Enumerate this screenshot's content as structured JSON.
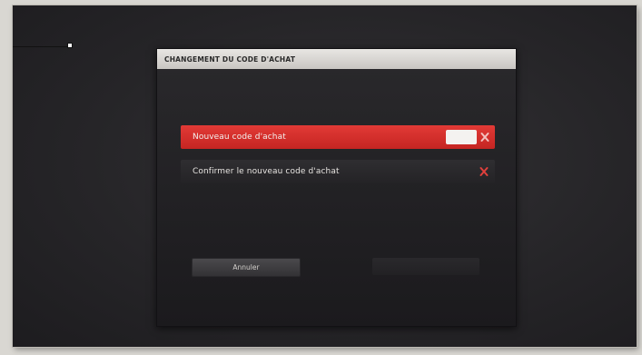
{
  "dialog": {
    "title": "CHANGEMENT DU CODE D'ACHAT",
    "fields": [
      {
        "label": "Nouveau code d'achat",
        "state": "focused"
      },
      {
        "label": "Confirmer le nouveau code d'achat",
        "state": "idle"
      }
    ],
    "cancel_label": "Annuler",
    "confirm_label": ""
  },
  "icons": {
    "clear": "close-icon"
  },
  "colors": {
    "accent": "#d62e2b",
    "dialog_bg": "#1f1e21",
    "header_bg": "#d8d6d2",
    "paper": "#d9d7d2"
  }
}
